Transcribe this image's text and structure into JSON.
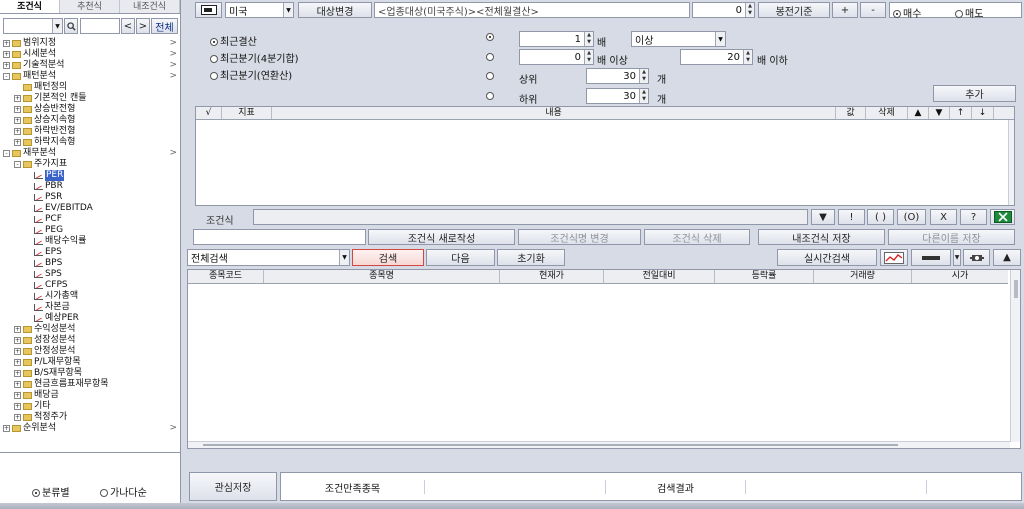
{
  "left": {
    "tabs": [
      "조건식",
      "추천식",
      "내조건식"
    ],
    "active_tab": "조건식",
    "search": {
      "all_label": "전체",
      "prev": "<",
      "next": ">"
    },
    "tree": [
      {
        "label": "범위지정",
        "level": 0,
        "type": "folder",
        "expander": "+",
        "chevron": ">"
      },
      {
        "label": "시세분석",
        "level": 0,
        "type": "folder",
        "expander": "+",
        "chevron": ">"
      },
      {
        "label": "기술적분석",
        "level": 0,
        "type": "folder",
        "expander": "+",
        "chevron": ">"
      },
      {
        "label": "패턴분석",
        "level": 0,
        "type": "folder",
        "expander": "-",
        "chevron": ">"
      },
      {
        "label": "패턴정의",
        "level": 1,
        "type": "folder",
        "expander": "",
        "chevron": ""
      },
      {
        "label": "기본적인 캔들",
        "level": 1,
        "type": "folder",
        "expander": "+",
        "chevron": ""
      },
      {
        "label": "상승반전형",
        "level": 1,
        "type": "folder",
        "expander": "+",
        "chevron": ""
      },
      {
        "label": "상승지속형",
        "level": 1,
        "type": "folder",
        "expander": "+",
        "chevron": ""
      },
      {
        "label": "하락반전형",
        "level": 1,
        "type": "folder",
        "expander": "+",
        "chevron": ""
      },
      {
        "label": "하락지속형",
        "level": 1,
        "type": "folder",
        "expander": "+",
        "chevron": ""
      },
      {
        "label": "재무분석",
        "level": 0,
        "type": "folder",
        "expander": "-",
        "chevron": ">"
      },
      {
        "label": "주가지표",
        "level": 1,
        "type": "folder",
        "expander": "-",
        "chevron": ""
      },
      {
        "label": "PER",
        "level": 2,
        "type": "leaf",
        "expander": "",
        "chevron": "",
        "selected": true
      },
      {
        "label": "PBR",
        "level": 2,
        "type": "leaf",
        "expander": "",
        "chevron": ""
      },
      {
        "label": "PSR",
        "level": 2,
        "type": "leaf",
        "expander": "",
        "chevron": ""
      },
      {
        "label": "EV/EBITDA",
        "level": 2,
        "type": "leaf",
        "expander": "",
        "chevron": ""
      },
      {
        "label": "PCF",
        "level": 2,
        "type": "leaf",
        "expander": "",
        "chevron": ""
      },
      {
        "label": "PEG",
        "level": 2,
        "type": "leaf",
        "expander": "",
        "chevron": ""
      },
      {
        "label": "배당수익률",
        "level": 2,
        "type": "leaf",
        "expander": "",
        "chevron": ""
      },
      {
        "label": "EPS",
        "level": 2,
        "type": "leaf",
        "expander": "",
        "chevron": ""
      },
      {
        "label": "BPS",
        "level": 2,
        "type": "leaf",
        "expander": "",
        "chevron": ""
      },
      {
        "label": "SPS",
        "level": 2,
        "type": "leaf",
        "expander": "",
        "chevron": ""
      },
      {
        "label": "CFPS",
        "level": 2,
        "type": "leaf",
        "expander": "",
        "chevron": ""
      },
      {
        "label": "시가총액",
        "level": 2,
        "type": "leaf",
        "expander": "",
        "chevron": ""
      },
      {
        "label": "자본금",
        "level": 2,
        "type": "leaf",
        "expander": "",
        "chevron": ""
      },
      {
        "label": "예상PER",
        "level": 2,
        "type": "leaf",
        "expander": "",
        "chevron": ""
      },
      {
        "label": "수익성분석",
        "level": 1,
        "type": "folder",
        "expander": "+",
        "chevron": ""
      },
      {
        "label": "성장성분석",
        "level": 1,
        "type": "folder",
        "expander": "+",
        "chevron": ""
      },
      {
        "label": "안정성분석",
        "level": 1,
        "type": "folder",
        "expander": "+",
        "chevron": ""
      },
      {
        "label": "P/L재무항목",
        "level": 1,
        "type": "folder",
        "expander": "+",
        "chevron": ""
      },
      {
        "label": "B/S재무항목",
        "level": 1,
        "type": "folder",
        "expander": "+",
        "chevron": ""
      },
      {
        "label": "현금흐름표재무항목",
        "level": 1,
        "type": "folder",
        "expander": "+",
        "chevron": ""
      },
      {
        "label": "배당금",
        "level": 1,
        "type": "folder",
        "expander": "+",
        "chevron": ""
      },
      {
        "label": "기타",
        "level": 1,
        "type": "folder",
        "expander": "+",
        "chevron": ""
      },
      {
        "label": "적정주가",
        "level": 1,
        "type": "folder",
        "expander": "+",
        "chevron": ""
      },
      {
        "label": "순위분석",
        "level": 0,
        "type": "folder",
        "expander": "+",
        "chevron": ">"
      }
    ],
    "sort_options": {
      "by_category": "분류별",
      "alphabetical": "가나다순"
    }
  },
  "toolbar": {
    "market": "미국",
    "target_change": "대상변경",
    "target_desc": "<업종대상(미국주식)><전체월결산>",
    "count": "0",
    "candle_basis": "봉전기준",
    "plus": "+",
    "minus": "-",
    "buy": "매수",
    "sell": "매도"
  },
  "criteria": {
    "period_options": [
      "최근결산",
      "최근분기(4분기합)",
      "최근분기(연환산)"
    ],
    "row1": {
      "value": "1",
      "unit": "배",
      "compare": "이상"
    },
    "row2": {
      "min": "0",
      "unit_min": "배 이상",
      "max": "20",
      "unit_max": "배 이하"
    },
    "row3": {
      "label": "상위",
      "value": "30",
      "unit": "개"
    },
    "row4": {
      "label": "하위",
      "value": "30",
      "unit": "개"
    },
    "add": "추가"
  },
  "index_table": {
    "headers": [
      "√",
      "지표",
      "내용",
      "값",
      "삭제",
      "▲",
      "▼",
      "↑",
      "↓"
    ]
  },
  "formula": {
    "label": "조건식",
    "buttons": [
      "!",
      "( )",
      "(O)",
      "X",
      "?"
    ]
  },
  "actions": {
    "new": "조건식 새로작성",
    "rename": "조건식명 변경",
    "delete": "조건식 삭제",
    "save": "내조건식 저장",
    "save_as": "다른이름 저장"
  },
  "search_bar": {
    "scope": "전체검색",
    "search": "검색",
    "next": "다음",
    "reset": "초기화",
    "realtime": "실시간검색"
  },
  "results": {
    "headers": [
      "종목코드",
      "종목명",
      "현재가",
      "전일대비",
      "등락률",
      "거래량",
      "시가"
    ]
  },
  "bottom": {
    "save_watch": "관심저장",
    "tabs": [
      "조건만족종목",
      "",
      "검색결과",
      ""
    ]
  }
}
